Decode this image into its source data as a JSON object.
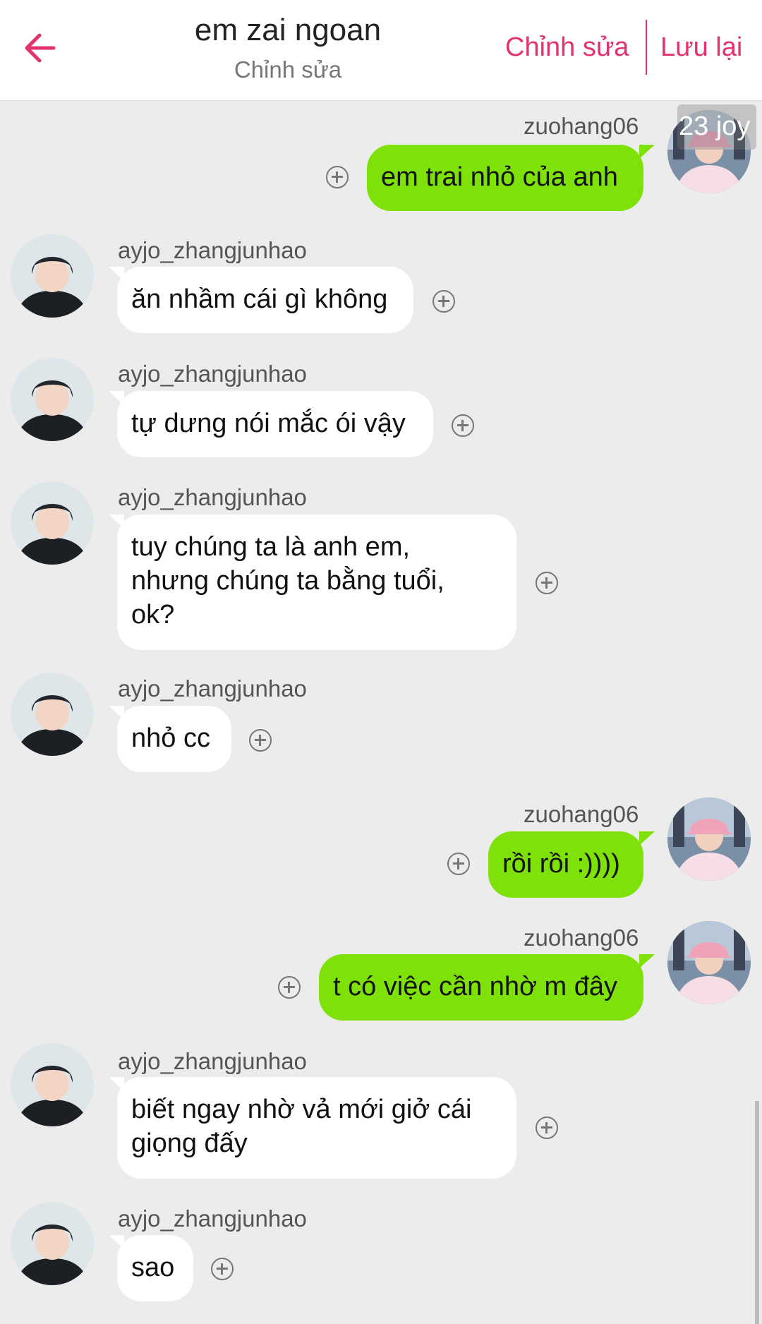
{
  "header": {
    "title": "em zai ngoan",
    "subtitle": "Chỉnh sửa",
    "edit_label": "Chỉnh sửa",
    "save_label": "Lưu lại"
  },
  "badge": {
    "text": "23 joy"
  },
  "messages": [
    {
      "username": "zuohang06",
      "text": "em trai nhỏ của anh",
      "side": "out"
    },
    {
      "username": "ayjo_zhangjunhao",
      "text": "ăn nhầm cái gì không",
      "side": "in"
    },
    {
      "username": "ayjo_zhangjunhao",
      "text": "tự dưng nói mắc ói vậy",
      "side": "in"
    },
    {
      "username": "ayjo_zhangjunhao",
      "lines": [
        "tuy chúng ta là anh em,",
        "nhưng chúng ta bằng tuổi,",
        "ok?"
      ],
      "side": "in"
    },
    {
      "username": "ayjo_zhangjunhao",
      "text": "nhỏ cc",
      "side": "in"
    },
    {
      "username": "zuohang06",
      "text": "rồi rồi :))))",
      "side": "out"
    },
    {
      "username": "zuohang06",
      "text": "t có việc cần nhờ m đây",
      "side": "out"
    },
    {
      "username": "ayjo_zhangjunhao",
      "lines": [
        "biết ngay nhờ vả mới giở cái",
        "giọng đấy"
      ],
      "side": "in"
    },
    {
      "username": "ayjo_zhangjunhao",
      "text": "sao",
      "side": "in"
    }
  ],
  "icons": {
    "back": "arrow-left-icon",
    "add_reaction": "plus-circle-icon"
  },
  "colors": {
    "accent": "#e2336f",
    "outgoing_bubble": "#7ee208",
    "incoming_bubble": "#ffffff",
    "background": "#ececec"
  }
}
